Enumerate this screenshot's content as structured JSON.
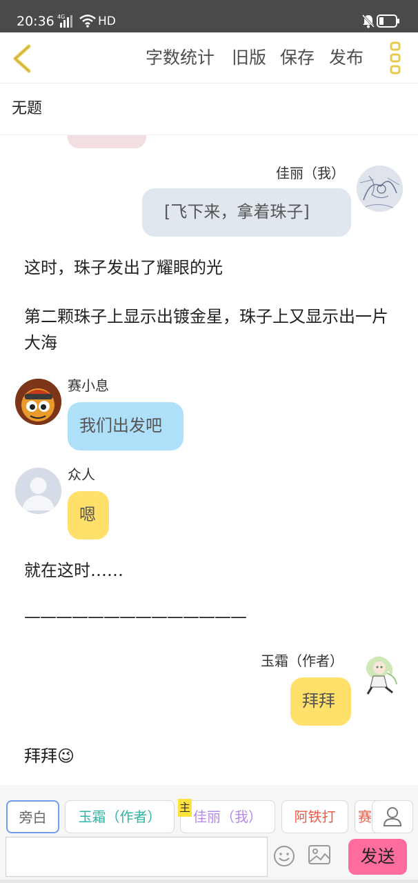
{
  "status_bar": {
    "time": "20:36",
    "network": "4G",
    "hd": "HD"
  },
  "header": {
    "word_count": "字数统计",
    "old_version": "旧版",
    "save": "保存",
    "publish": "发布"
  },
  "title": "无题",
  "messages": [
    {
      "speaker": "佳丽（我）",
      "text": "[飞下来，拿着珠子]"
    },
    {
      "narration": "这时，珠子发出了耀眼的光"
    },
    {
      "narration": "第二颗珠子上显示出镀金星，珠子上又显示出一片大海"
    },
    {
      "speaker": "赛小息",
      "text": "我们出发吧"
    },
    {
      "speaker": "众人",
      "text": "嗯"
    },
    {
      "narration": "就在这时……"
    },
    {
      "narration": "——————————————"
    },
    {
      "speaker": "玉霜（作者）",
      "text": "拜拜"
    },
    {
      "narration": "拜拜",
      "emoji": "😉"
    }
  ],
  "roles": [
    {
      "label": "旁白"
    },
    {
      "label": "玉霜（作者）"
    },
    {
      "label": "佳丽（我）",
      "mark": "主"
    },
    {
      "label": "阿铁打"
    },
    {
      "label": "赛"
    }
  ],
  "input": {
    "value": "",
    "send_label": "发送"
  },
  "colors": {
    "accent_yellow": "#e9c84b",
    "bubble_gray": "#e1e7ef",
    "bubble_blue": "#aee0fa",
    "bubble_yellow": "#ffe06b",
    "send_pink": "#ff6c9e",
    "role_author": "#2fb3a6",
    "role_me": "#b58ae6",
    "role_atieda": "#ee5a45"
  }
}
